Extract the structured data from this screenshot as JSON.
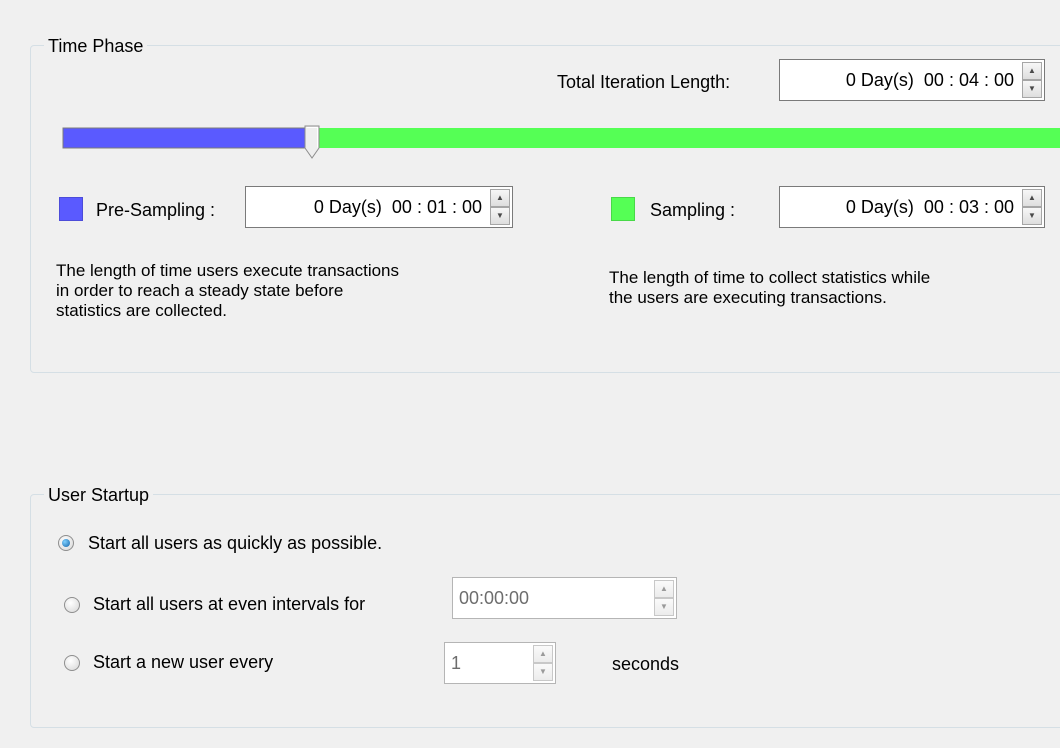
{
  "time_phase": {
    "group_label": "Time Phase",
    "total_iteration_label": "Total Iteration Length:",
    "total_iteration_value": "0 Day(s)  00 : 04 : 00",
    "slider": {
      "pre_sampling_fraction": 0.25,
      "pre_color": "#5a5aff",
      "sampling_color": "#55ff55"
    },
    "pre_sampling": {
      "label": "Pre-Sampling :",
      "value": "0 Day(s)  00 : 01 : 00",
      "color": "#5a5aff",
      "description_lines": [
        "The length of time users execute transactions",
        "in order to reach a steady state before",
        "statistics are collected."
      ]
    },
    "sampling": {
      "label": "Sampling :",
      "value": "0 Day(s)  00 : 03 : 00",
      "color": "#55ff55",
      "description_lines": [
        "The length of time to collect statistics while",
        "the users are executing transactions."
      ]
    }
  },
  "user_startup": {
    "group_label": "User Startup",
    "options": [
      {
        "label": "Start all users as quickly as possible.",
        "checked": true
      },
      {
        "label": "Start all users at even intervals for",
        "checked": false
      },
      {
        "label": "Start a new user every",
        "checked": false
      }
    ],
    "interval_value": "00:00:00",
    "every_value": "1",
    "seconds_label": "seconds"
  }
}
